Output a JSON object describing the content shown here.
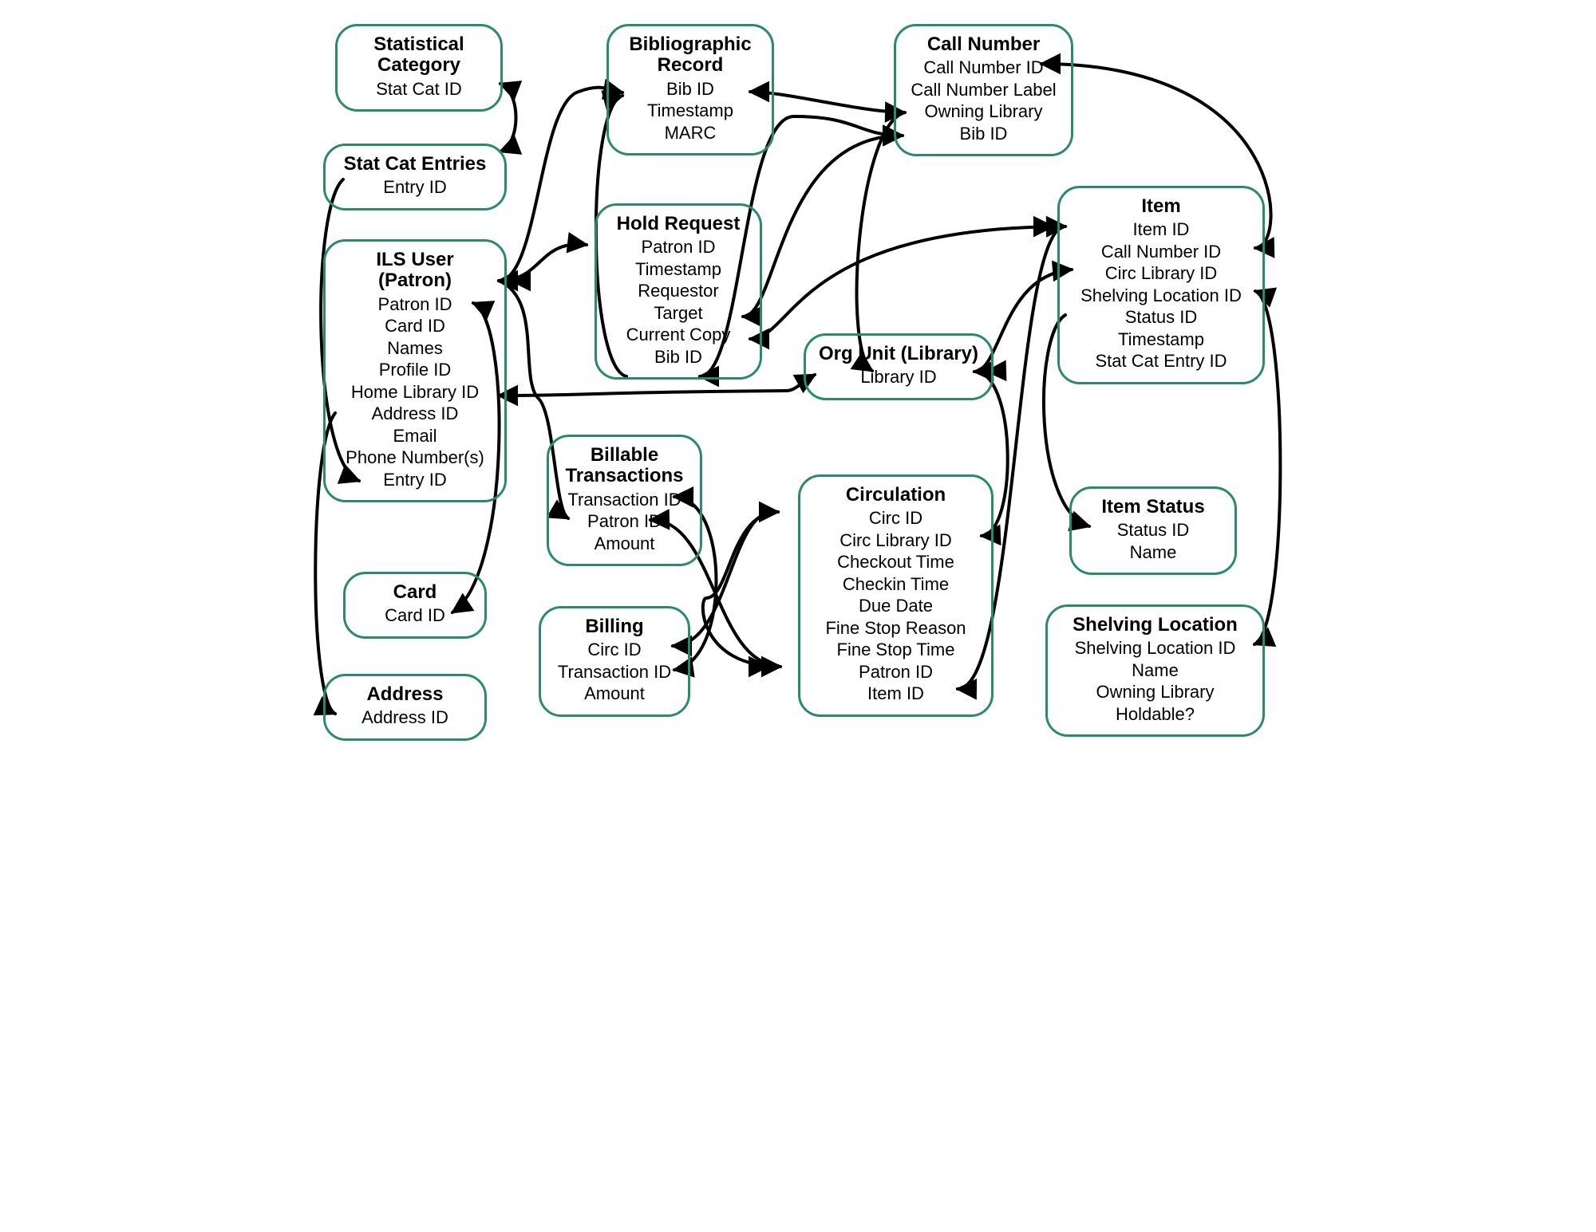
{
  "entities": {
    "statcat": {
      "title": "Statistical Category",
      "fields": [
        "Stat Cat ID"
      ]
    },
    "statentries": {
      "title": "Stat Cat Entries",
      "fields": [
        "Entry ID"
      ]
    },
    "ilsuser": {
      "title": "ILS User (Patron)",
      "fields": [
        "Patron ID",
        "Card ID",
        "Names",
        "Profile ID",
        "Home Library ID",
        "Address ID",
        "Email",
        "Phone Number(s)",
        "Entry ID"
      ]
    },
    "card": {
      "title": "Card",
      "fields": [
        "Card ID"
      ]
    },
    "address": {
      "title": "Address",
      "fields": [
        "Address ID"
      ]
    },
    "bib": {
      "title": "Bibliographic Record",
      "fields": [
        "Bib ID",
        "Timestamp",
        "MARC"
      ]
    },
    "hold": {
      "title": "Hold Request",
      "fields": [
        "Patron ID",
        "Timestamp",
        "Requestor",
        "Target",
        "Current Copy",
        "Bib ID"
      ]
    },
    "billtx": {
      "title": "Billable Transactions",
      "fields": [
        "Transaction ID",
        "Patron ID",
        "Amount"
      ]
    },
    "billing": {
      "title": "Billing",
      "fields": [
        "Circ ID",
        "Transaction ID",
        "Amount"
      ]
    },
    "callno": {
      "title": "Call Number",
      "fields": [
        "Call Number ID",
        "Call Number Label",
        "Owning Library",
        "Bib ID"
      ]
    },
    "org": {
      "title": "Org Unit (Library)",
      "fields": [
        "Library ID"
      ]
    },
    "circ": {
      "title": "Circulation",
      "fields": [
        "Circ ID",
        "Circ Library ID",
        "Checkout Time",
        "Checkin Time",
        "Due Date",
        "Fine Stop Reason",
        "Fine Stop Time",
        "Patron ID",
        "Item ID"
      ]
    },
    "item": {
      "title": "Item",
      "fields": [
        "Item ID",
        "Call Number ID",
        "Circ Library ID",
        "Shelving Location ID",
        "Status ID",
        "Timestamp",
        "Stat Cat Entry ID"
      ]
    },
    "itemstatus": {
      "title": "Item Status",
      "fields": [
        "Status ID",
        "Name"
      ]
    },
    "shelving": {
      "title": "Shelving Location",
      "fields": [
        "Shelving Location ID",
        "Name",
        "Owning Library",
        "Holdable?"
      ]
    }
  }
}
